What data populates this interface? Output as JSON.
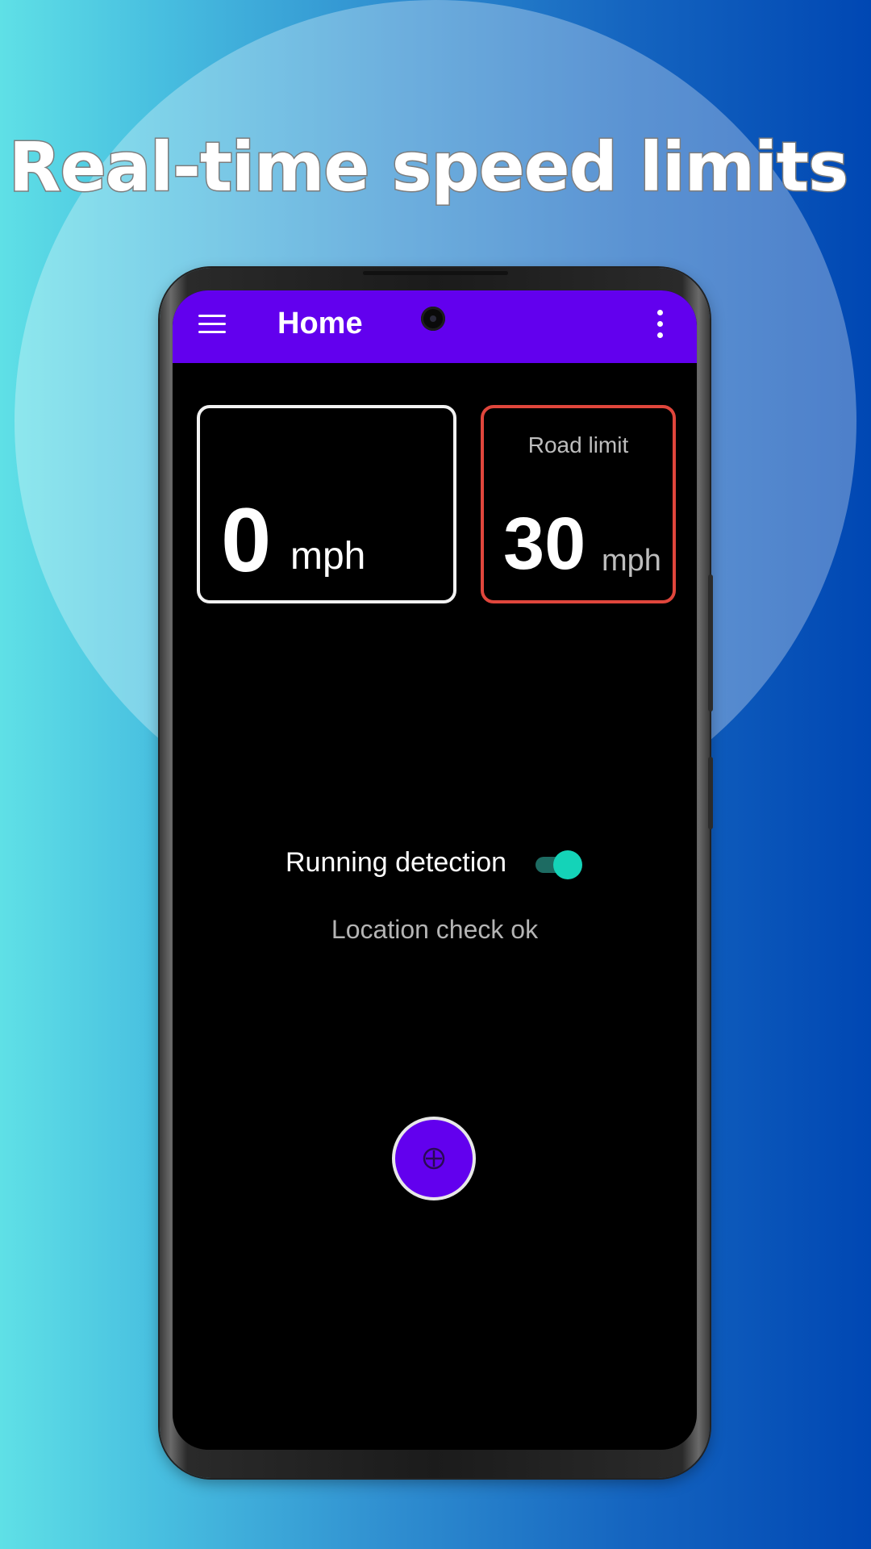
{
  "promo": {
    "headline": "Real-time speed limits"
  },
  "appbar": {
    "title": "Home",
    "menu_icon": "hamburger-menu-icon",
    "overflow_icon": "more-vertical-icon",
    "color": "#6200ee"
  },
  "speed": {
    "value": "0",
    "unit": "mph"
  },
  "road_limit": {
    "label": "Road limit",
    "value": "30",
    "unit": "mph",
    "border_color": "#e0463c"
  },
  "detection": {
    "label": "Running detection",
    "enabled": true,
    "toggle_color": "#14d3b8"
  },
  "status": {
    "text": "Location check ok"
  },
  "fab": {
    "icon": "target-plus-icon",
    "color": "#6200ee"
  }
}
